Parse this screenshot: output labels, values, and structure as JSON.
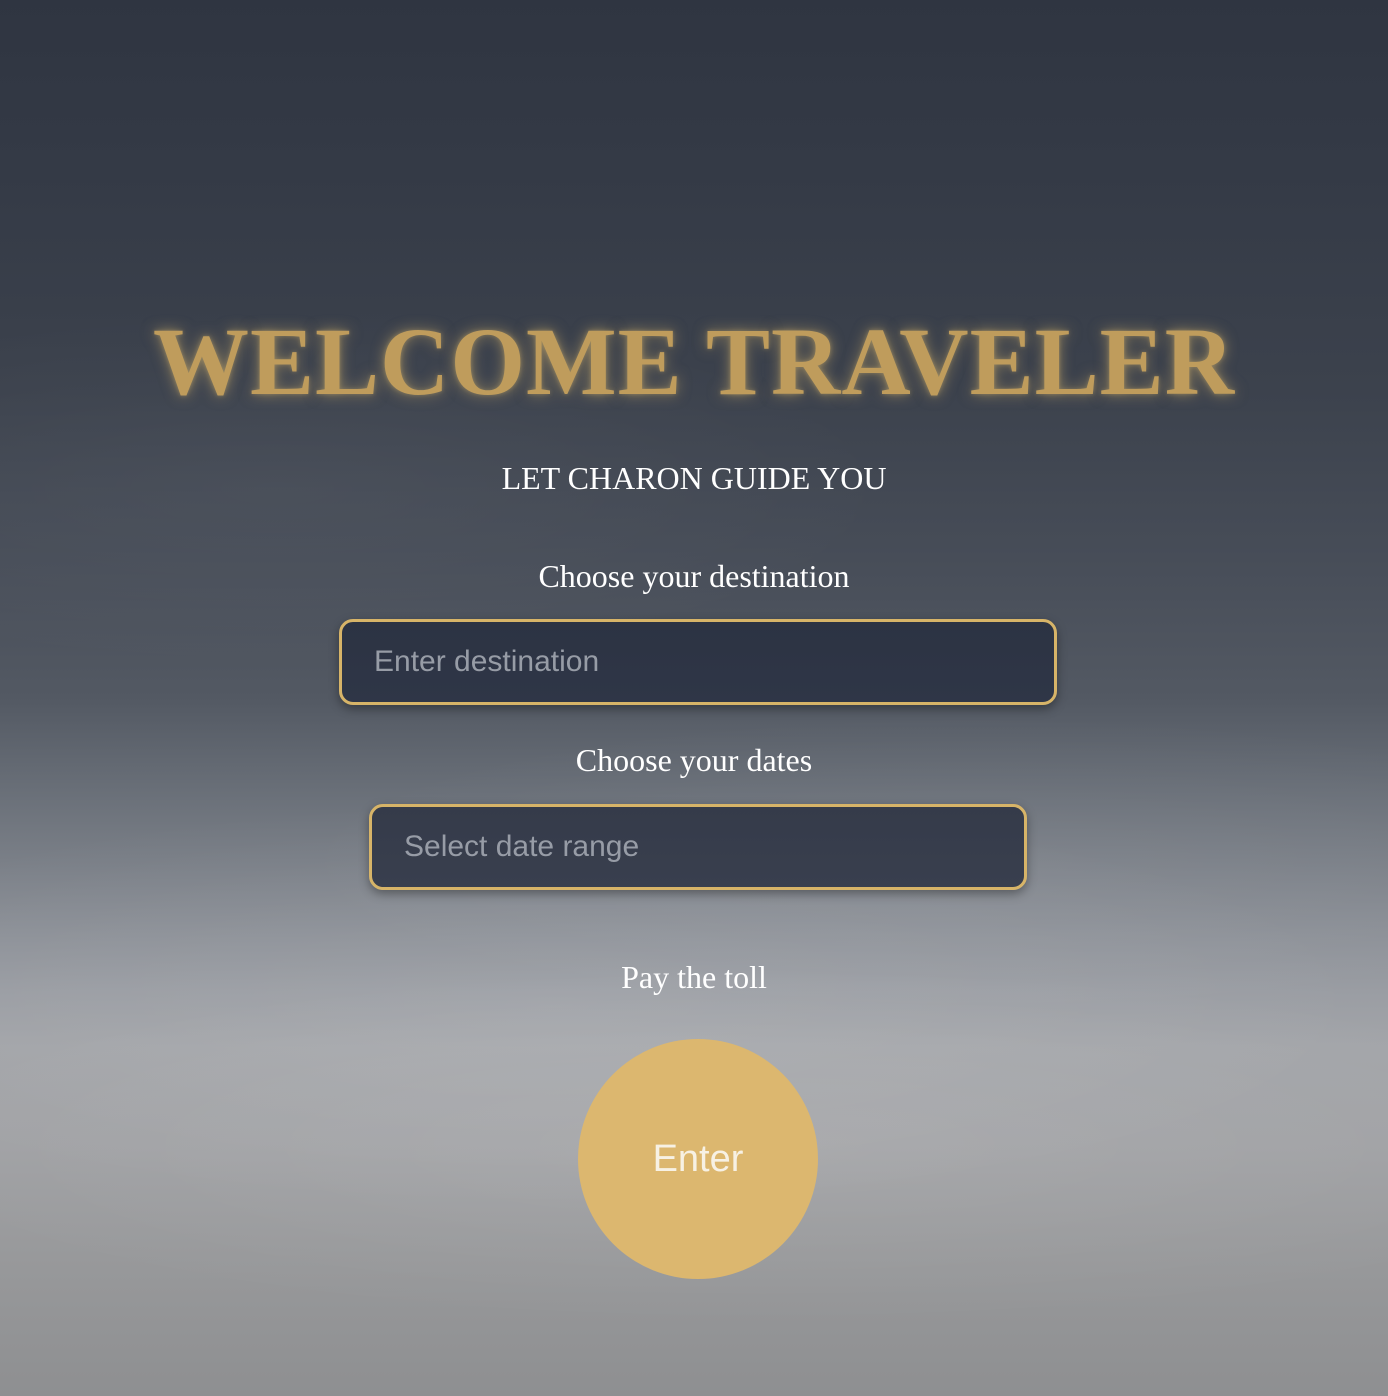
{
  "hero": {
    "title": "WELCOME TRAVELER",
    "subtitle": "LET CHARON GUIDE YOU"
  },
  "form": {
    "destination": {
      "label": "Choose your destination",
      "placeholder": "Enter destination",
      "value": ""
    },
    "dates": {
      "label": "Choose your dates",
      "placeholder": "Select date range",
      "value": ""
    },
    "toll": {
      "label": "Pay the toll",
      "button_label": "Enter"
    }
  },
  "colors": {
    "accent_gold": "#dcb76f",
    "title_gold": "#bf9c5c",
    "field_background": "#2c3343",
    "text_white": "#ffffff"
  }
}
